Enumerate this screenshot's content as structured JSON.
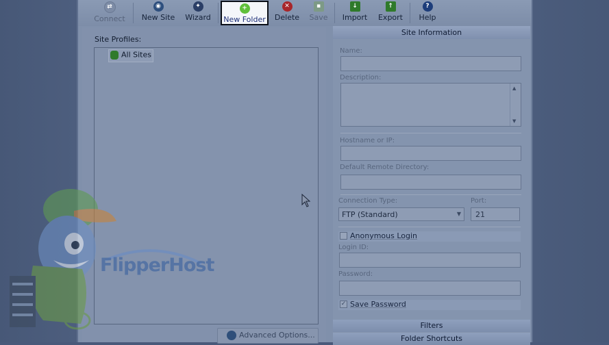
{
  "toolbar": {
    "buttons": [
      {
        "label": "Connect",
        "icon": "connect-icon",
        "state": "disabled"
      },
      {
        "label": "New Site",
        "icon": "new-site-icon",
        "state": "enabled"
      },
      {
        "label": "Wizard",
        "icon": "wizard-icon",
        "state": "enabled"
      },
      {
        "label": "New Folder",
        "icon": "new-folder-icon",
        "state": "highlighted"
      },
      {
        "label": "Delete",
        "icon": "delete-icon",
        "state": "enabled"
      },
      {
        "label": "Save",
        "icon": "save-icon",
        "state": "disabled"
      },
      {
        "label": "Import",
        "icon": "import-icon",
        "state": "enabled"
      },
      {
        "label": "Export",
        "icon": "export-icon",
        "state": "enabled"
      },
      {
        "label": "Help",
        "icon": "help-icon",
        "state": "enabled"
      }
    ]
  },
  "site_panel": {
    "profiles_label": "Site Profiles:",
    "tree_root": "All Sites",
    "advanced_button": "Advanced Options..."
  },
  "info_panel": {
    "header": "Site Information",
    "name_label": "Name:",
    "name_value": "",
    "description_label": "Description:",
    "description_value": "",
    "hostname_label": "Hostname or IP:",
    "hostname_value": "",
    "remote_dir_label": "Default Remote Directory:",
    "remote_dir_value": "",
    "connection_type_label": "Connection Type:",
    "connection_type_value": "FTP (Standard)",
    "port_label": "Port:",
    "port_value": "21",
    "anonymous_login_label": "Anonymous Login",
    "anonymous_login_checked": false,
    "login_id_label": "Login ID:",
    "login_id_value": "",
    "password_label": "Password:",
    "password_value": "",
    "save_password_label": "Save Password",
    "save_password_checked": true,
    "filters_label": "Filters",
    "folder_shortcuts_label": "Folder Shortcuts"
  },
  "watermark": {
    "brand_text": "FlipperHost"
  },
  "colors": {
    "overlay": "#49597a",
    "highlight_border": "#0b0f18",
    "delete_icon": "#a8262a",
    "help_icon": "#1d3d7a",
    "green_icon": "#2f7a2b"
  }
}
